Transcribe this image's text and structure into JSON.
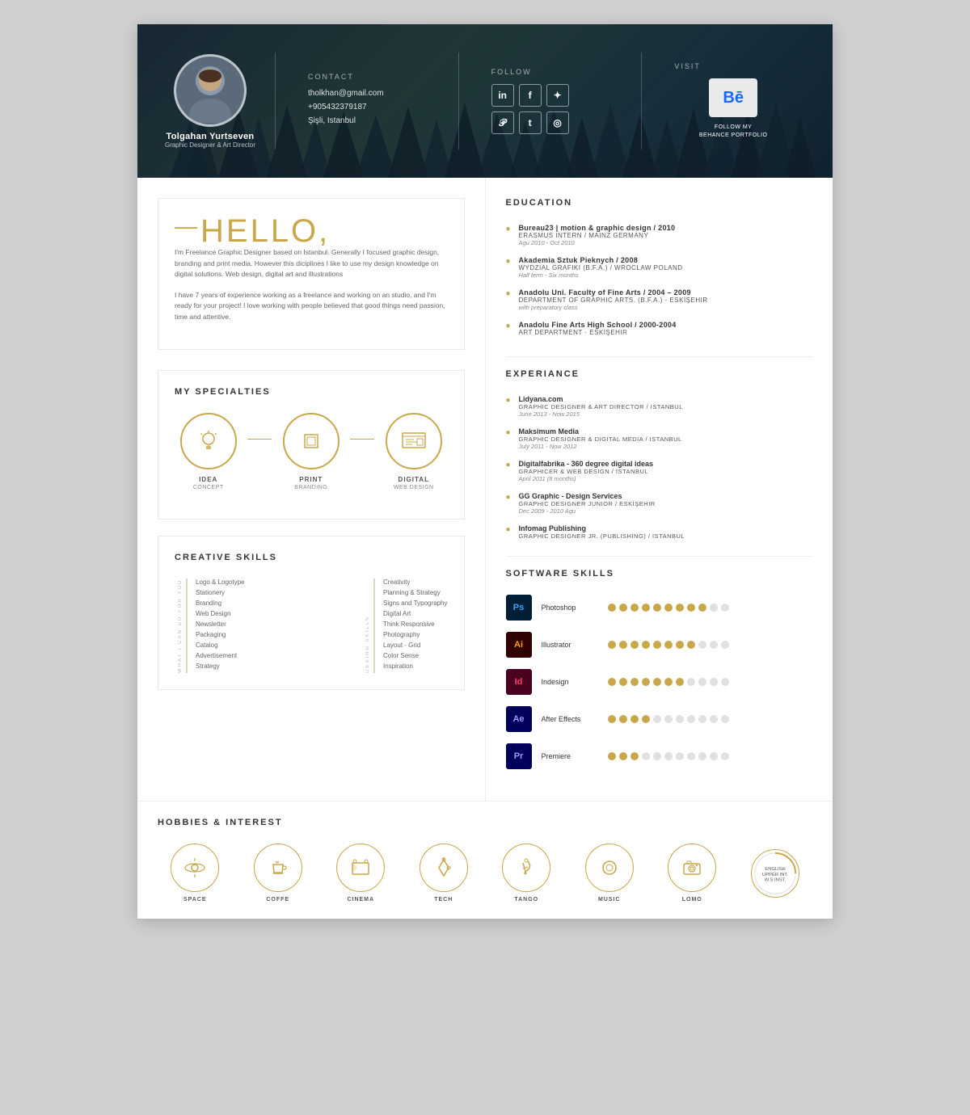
{
  "header": {
    "name": "Tolgahan Yurtseven",
    "title": "Graphic Designer & Art Director",
    "contact": {
      "label": "Contact",
      "email": "tholkhan@gmail.com",
      "phone": "+905432379187",
      "location": "Şişli, Istanbul"
    },
    "follow": {
      "label": "Follow",
      "networks": [
        "in",
        "f",
        "t",
        "p",
        "t",
        "ig"
      ]
    },
    "visit": {
      "label": "Visit",
      "behance_label": "FOLLOW MY\nBEHANCE PORTFOLIO"
    }
  },
  "hello": {
    "dash": "—",
    "title": "HELLO,",
    "text1": "I'm Freelance Graphic Designer based on Istanbul. Generally I focused graphic design, branding and print media. However this diciplines I like to use my design knowledge on digital solutions. Web design, digital art and illustrations",
    "text2": "I have 7 years of experience working as a freelance and working on an studio, and I'm ready for your project! I love working with people believed that good things need passion, time and attentive."
  },
  "specialties": {
    "title": "MY SPECIALTIES",
    "items": [
      {
        "icon": "💡",
        "label": "IDEA",
        "sublabel": "CONCEPT"
      },
      {
        "icon": "🖨",
        "label": "PRINT",
        "sublabel": "BRANDING"
      },
      {
        "icon": "🖥",
        "label": "DIGITAL",
        "sublabel": "WEB DESIGN"
      }
    ]
  },
  "creative_skills": {
    "title": "CREATIVE SKILLS",
    "what_i_can_do": "WHAT I CAN DO FOR YOU",
    "design_skills": "DESING SKILLS",
    "left_items": [
      "Logo & Logotype",
      "Stationery",
      "Branding",
      "Web Design",
      "Newsletter",
      "Packaging",
      "Catalog",
      "Advertisement",
      "Strategy"
    ],
    "right_items": [
      "Creativity",
      "Planning & Strategy",
      "Signs and Typography",
      "Digital Art",
      "Think Responsive",
      "Photography",
      "Layout - Grid",
      "Color Sense",
      "Inspiration"
    ]
  },
  "education": {
    "title": "EDUCATION",
    "items": [
      {
        "name": "Bureau23 | motion & graphic design / 2010",
        "subtitle": "ERASMUS INTERN / MAINZ GERMANY",
        "date": "Agu 2010 - Oct 2010"
      },
      {
        "name": "Akademia Sztuk Pieknych / 2008",
        "subtitle": "WYDZIAL GRAFIKI (B.F.A.) / WROCLAW POLAND",
        "date": "Half term - Six months"
      },
      {
        "name": "Anadolu Uni. Faculty of Fine Arts / 2004 – 2009",
        "subtitle": "DEPARTMENT OF GRAPHIC ARTS. (B.F.A.) - ESKİŞEHIR",
        "date": "with preparatory class"
      },
      {
        "name": "Anadolu Fine Arts High School / 2000-2004",
        "subtitle": "ART DEPARTMENT · ESKİŞEHIR",
        "date": ""
      }
    ]
  },
  "experience": {
    "title": "EXPERIANCE",
    "items": [
      {
        "company": "Lidyana.com",
        "role": "GRAPHIC DESIGNER & ART DIRECTOR / ISTANBUL",
        "date": "June 2013 - Now 2015"
      },
      {
        "company": "Maksimum Media",
        "role": "GRAPHIC DESIGNER & DIGITAL MEDIA / ISTANBUL",
        "date": "July 2011 - Now 2012"
      },
      {
        "company": "Digitalfabrika - 360 degree digital ideas",
        "role": "GRAPHICER & WEB DESIGN / ISTANBUL",
        "date": "April 2011 (8 months)"
      },
      {
        "company": "GG Graphic - Design Services",
        "role": "GRAPHIC DESIGNER JUNIOR / ESKİŞEHIR",
        "date": "Dec 2009 - 2010 Agu"
      },
      {
        "company": "Infomag Publishing",
        "role": "GRAPHIC DESIGNER JR. (PUBLISHING) / ISTANBUL",
        "date": ""
      }
    ]
  },
  "software_skills": {
    "title": "SOFTWARE SKILLS",
    "items": [
      {
        "name": "Photoshop",
        "abbr": "Ps",
        "box_class": "ps-box",
        "filled": 9,
        "empty": 2
      },
      {
        "name": "Illustrator",
        "abbr": "Ai",
        "box_class": "ai-box",
        "filled": 8,
        "empty": 3
      },
      {
        "name": "Indesign",
        "abbr": "Id",
        "box_class": "id-box",
        "filled": 7,
        "empty": 4
      },
      {
        "name": "After Effects",
        "abbr": "Ae",
        "box_class": "ae-box",
        "filled": 4,
        "empty": 7
      },
      {
        "name": "Premiere",
        "abbr": "Pr",
        "box_class": "pr-box",
        "filled": 3,
        "empty": 8
      }
    ]
  },
  "hobbies": {
    "title": "HOBBIES & INTEREST",
    "items": [
      {
        "icon": "🔭",
        "label": "SPACE"
      },
      {
        "icon": "☕",
        "label": "COFFE"
      },
      {
        "icon": "🎬",
        "label": "CINEMA"
      },
      {
        "icon": "🚀",
        "label": "TECH"
      },
      {
        "icon": "👠",
        "label": "TANGO"
      },
      {
        "icon": "🎧",
        "label": "MUSIC"
      },
      {
        "icon": "📷",
        "label": "LOMO"
      }
    ],
    "language_label": "ENGLISH\nUPPER INT.\nW.S.INST."
  }
}
